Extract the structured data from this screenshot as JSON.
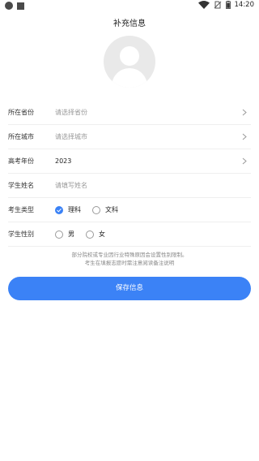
{
  "status_bar": {
    "time": "14:20"
  },
  "page": {
    "title": "补充信息"
  },
  "form": {
    "province": {
      "label": "所在省份",
      "placeholder": "请选择省份"
    },
    "city": {
      "label": "所在城市",
      "placeholder": "请选择城市"
    },
    "year": {
      "label": "高考年份",
      "value": "2023"
    },
    "name": {
      "label": "学生姓名",
      "placeholder": "请填写姓名"
    },
    "type": {
      "label": "考生类型",
      "options": [
        "理科",
        "文科"
      ],
      "selected": "理科"
    },
    "gender": {
      "label": "学生性别",
      "options": [
        "男",
        "女"
      ],
      "selected": ""
    }
  },
  "note": {
    "line1": "部分院校或专业因行业特殊原因会设置性别限制。",
    "line2": "考生在填报志愿时需注意阅读备注说明"
  },
  "actions": {
    "save_label": "保存信息"
  },
  "colors": {
    "accent": "#3b82f6"
  }
}
